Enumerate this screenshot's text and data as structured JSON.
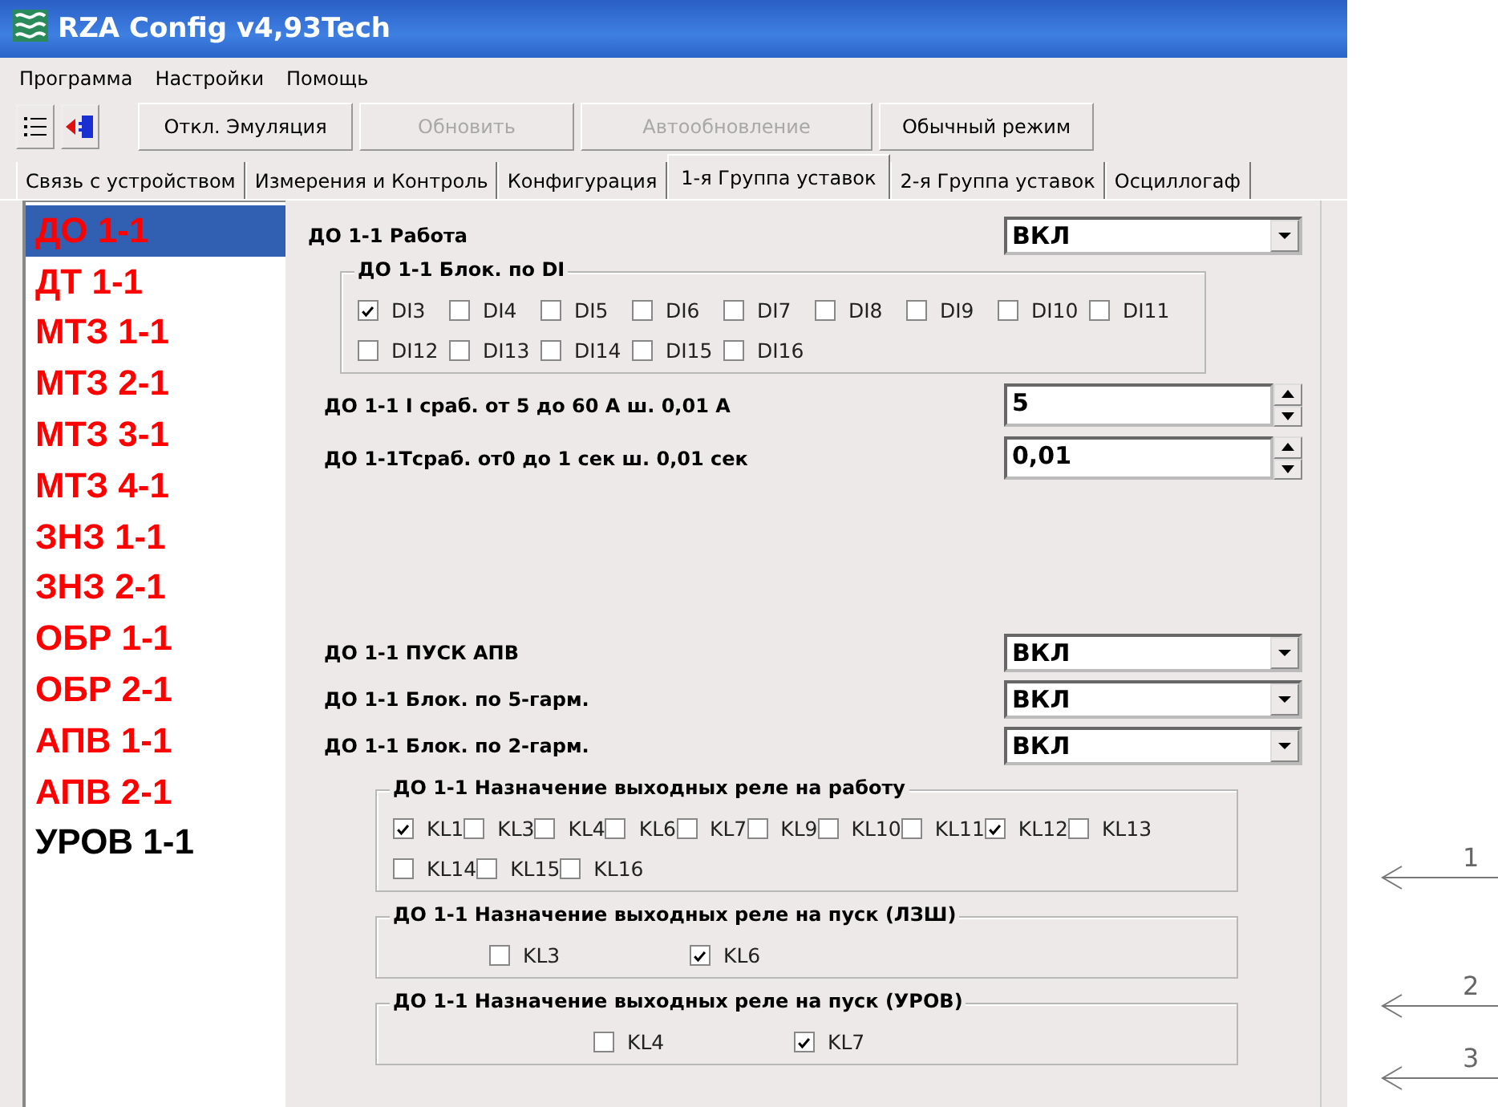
{
  "window": {
    "title": "RZA Config v4,93Tech"
  },
  "menu": [
    "Программа",
    "Настройки",
    "Помощь"
  ],
  "toolbar": [
    {
      "label": "Откл. Эмуляция",
      "disabled": false
    },
    {
      "label": "Обновить",
      "disabled": true
    },
    {
      "label": "Автообновление",
      "disabled": true
    },
    {
      "label": "Обычный режим",
      "disabled": false
    }
  ],
  "tabs": [
    {
      "label": "Связь с устройством",
      "selected": false
    },
    {
      "label": "Измерения и Контроль",
      "selected": false
    },
    {
      "label": "Конфигурация",
      "selected": false
    },
    {
      "label": "1-я Группа уставок",
      "selected": true
    },
    {
      "label": "2-я Группа уставок",
      "selected": false
    },
    {
      "label": "Осциллогаф",
      "selected": false
    }
  ],
  "protections": [
    {
      "label": "ДО 1-1",
      "selected": true,
      "color": "#ff0000"
    },
    {
      "label": "ДТ 1-1",
      "selected": false,
      "color": "#ff0000"
    },
    {
      "label": "МТЗ 1-1",
      "selected": false,
      "color": "#ff0000"
    },
    {
      "label": "МТЗ 2-1",
      "selected": false,
      "color": "#ff0000"
    },
    {
      "label": "МТЗ 3-1",
      "selected": false,
      "color": "#ff0000"
    },
    {
      "label": "МТЗ 4-1",
      "selected": false,
      "color": "#ff0000"
    },
    {
      "label": "ЗНЗ 1-1",
      "selected": false,
      "color": "#ff0000"
    },
    {
      "label": "ЗНЗ 2-1",
      "selected": false,
      "color": "#ff0000"
    },
    {
      "label": "ОБР 1-1",
      "selected": false,
      "color": "#ff0000"
    },
    {
      "label": "ОБР 2-1",
      "selected": false,
      "color": "#ff0000"
    },
    {
      "label": "АПВ 1-1",
      "selected": false,
      "color": "#ff0000"
    },
    {
      "label": "АПВ 2-1",
      "selected": false,
      "color": "#ff0000"
    },
    {
      "label": "УРОВ 1-1",
      "selected": false,
      "color": "#000000"
    }
  ],
  "upper_settings": [
    {
      "kind": "combo",
      "label": "ДО  1-1 Работа",
      "value": "ВКЛ"
    },
    {
      "kind": "checkgroup",
      "label": "ДО  1-1 Блок. по DI",
      "options": [
        {
          "label": "DI3",
          "checked": true
        },
        {
          "label": "DI4",
          "checked": false
        },
        {
          "label": "DI5",
          "checked": false
        },
        {
          "label": "DI6",
          "checked": false
        },
        {
          "label": "DI7",
          "checked": false
        },
        {
          "label": "DI8",
          "checked": false
        },
        {
          "label": "DI9",
          "checked": false
        },
        {
          "label": "DI10",
          "checked": false
        },
        {
          "label": "DI11",
          "checked": false
        },
        {
          "label": "DI12",
          "checked": false
        },
        {
          "label": "DI13",
          "checked": false
        },
        {
          "label": "DI14",
          "checked": false
        },
        {
          "label": "DI15",
          "checked": false
        },
        {
          "label": "DI16",
          "checked": false
        }
      ]
    },
    {
      "kind": "spin",
      "label": "ДО  1-1 I сраб. от 5 до 60 А ш. 0,01 А",
      "value": "5"
    },
    {
      "kind": "spin",
      "label": "ДО 1-1Тсраб. от0 до 1 сек ш. 0,01 сек",
      "value": "0,01"
    }
  ],
  "lower_settings": [
    {
      "kind": "combo",
      "label": "ДО 1-1 ПУСК АПВ",
      "value": "ВКЛ"
    },
    {
      "kind": "combo",
      "label": "ДО 1-1 Блок. по 5-гарм.",
      "value": "ВКЛ"
    },
    {
      "kind": "combo",
      "label": "ДО 1-1 Блок. по 2-гарм.",
      "value": "ВКЛ"
    },
    {
      "kind": "checkgroup",
      "label": "ДО 1-1 Назначение выходных реле на работу",
      "options": [
        {
          "label": "KL1",
          "checked": true
        },
        {
          "label": "KL3",
          "checked": false
        },
        {
          "label": "KL4",
          "checked": false
        },
        {
          "label": "KL6",
          "checked": false
        },
        {
          "label": "KL7",
          "checked": false
        },
        {
          "label": "KL9",
          "checked": false
        },
        {
          "label": "KL10",
          "checked": false
        },
        {
          "label": "KL11",
          "checked": false
        },
        {
          "label": "KL12",
          "checked": true
        },
        {
          "label": "KL13",
          "checked": false
        },
        {
          "label": "KL14",
          "checked": false
        },
        {
          "label": "KL15",
          "checked": false
        },
        {
          "label": "KL16",
          "checked": false
        }
      ]
    },
    {
      "kind": "checkgroup",
      "label": "ДО 1-1 Назначение выходных реле на пуск (ЛЗШ)",
      "options": [
        {
          "label": "KL3",
          "checked": false
        },
        {
          "label": "KL6",
          "checked": true
        }
      ]
    },
    {
      "kind": "checkgroup",
      "label": "ДО 1-1 Назначение выходных реле на пуск (УРОВ)",
      "options": [
        {
          "label": "KL4",
          "checked": false
        },
        {
          "label": "KL7",
          "checked": true
        }
      ]
    }
  ],
  "callouts": [
    "1",
    "2",
    "3"
  ]
}
